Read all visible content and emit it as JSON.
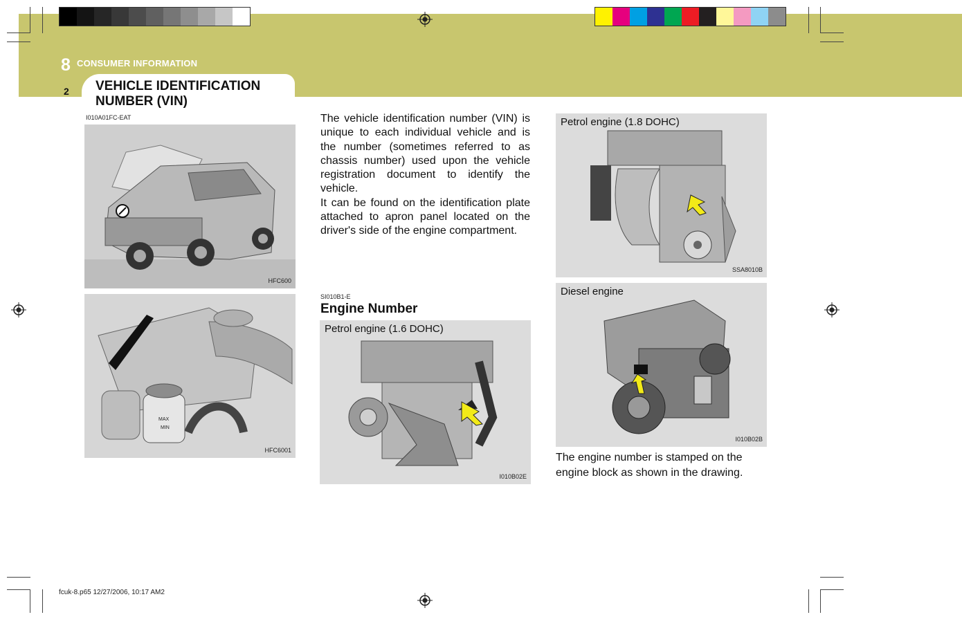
{
  "header": {
    "chapter_number": "8",
    "chapter_title": "CONSUMER INFORMATION",
    "page_number": "2",
    "section_title_line1": "VEHICLE IDENTIFICATION",
    "section_title_line2": "NUMBER (VIN)",
    "section_code": "I010A01FC-EAT"
  },
  "colors": {
    "band": "#c8c66e",
    "grayscale": [
      "#000000",
      "#141414",
      "#262626",
      "#383838",
      "#4c4c4c",
      "#606060",
      "#767676",
      "#8e8e8e",
      "#a8a8a8",
      "#c6c6c6",
      "#ffffff"
    ],
    "process": [
      "#fff200",
      "#e6007e",
      "#00a0e3",
      "#2e3192",
      "#00a651",
      "#ed1c24",
      "#231f20",
      "#fff799",
      "#f49ac1",
      "#8fd3f4",
      "#8c8c8c"
    ]
  },
  "figures": {
    "car": {
      "code": "HFC600"
    },
    "engine_bay": {
      "code": "HFC6001",
      "label_max": "MAX",
      "label_min": "MIN"
    },
    "petrol_16": {
      "caption": "Petrol engine (1.6 DOHC)",
      "code": "I010B02E"
    },
    "petrol_18": {
      "caption": "Petrol engine (1.8 DOHC)",
      "code": "SSA8010B"
    },
    "diesel": {
      "caption": "Diesel engine",
      "code": "I010B02B"
    }
  },
  "vin_text": {
    "para1": "The vehicle identification number (VIN) is unique to each individual vehicle and is the number (sometimes referred to as chassis number) used upon the vehicle registration document to identify the vehicle.",
    "para2": "It can be found on the identification plate attached to apron panel located on the driver's side of the engine compartment."
  },
  "engine_number": {
    "code": "SI010B1-E",
    "title": "Engine Number",
    "text": "The engine number is stamped on the engine block as shown in the drawing."
  },
  "footer": {
    "file_info": "fcuk-8.p65  12/27/2006, 10:17 AM2"
  }
}
